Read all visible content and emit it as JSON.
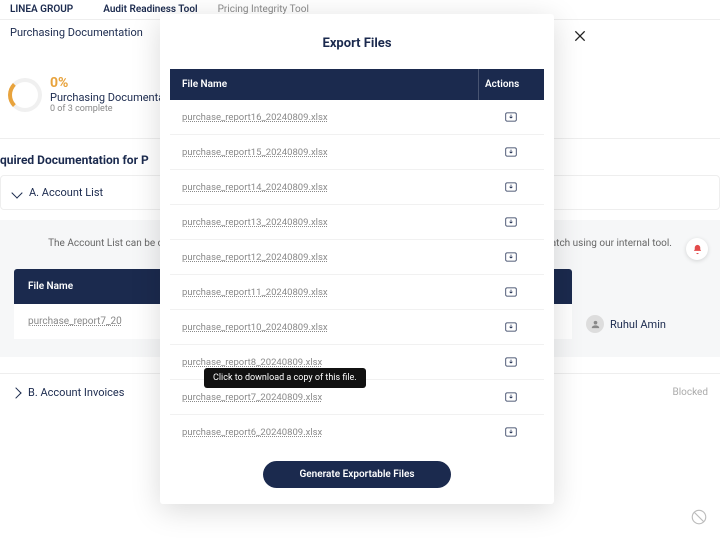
{
  "nav": {
    "brand": "LINEA GROUP",
    "link1": "Audit Readiness Tool",
    "link2": "Pricing Integrity Tool"
  },
  "crumb": "Purchasing Documentation",
  "progress": {
    "pct": "0%",
    "title": "Purchasing Documenta",
    "sub": "0 of 3 complete"
  },
  "section_heading": "quired Documentation for P",
  "accA": {
    "label": "A. Account List"
  },
  "accB": {
    "label": "B. Account Invoices",
    "status": "Blocked"
  },
  "panel": {
    "desc_left": "The Account List can be com",
    "desc_right": "cratch using our internal tool.",
    "col1": "File Name",
    "row1": "purchase_report7_20",
    "assignee": "Ruhul Amin"
  },
  "modal": {
    "title": "Export Files",
    "col_file": "File Name",
    "col_actions": "Actions",
    "tooltip": "Click to download a copy of this file.",
    "gen_btn": "Generate Exportable Files",
    "files": [
      "purchase_report16_20240809.xlsx",
      "purchase_report15_20240809.xlsx",
      "purchase_report14_20240809.xlsx",
      "purchase_report13_20240809.xlsx",
      "purchase_report12_20240809.xlsx",
      "purchase_report11_20240809.xlsx",
      "purchase_report10_20240809.xlsx",
      "purchase_report8_20240809.xlsx",
      "purchase_report7_20240809.xlsx",
      "purchase_report6_20240809.xlsx"
    ]
  }
}
